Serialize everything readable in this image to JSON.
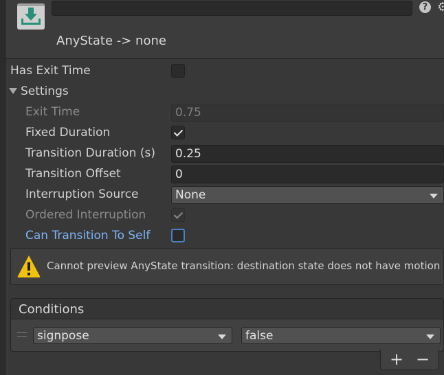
{
  "header": {
    "title": "AnyState -> none",
    "name_value": "",
    "icons": [
      "transition-icon",
      "help-icon",
      "gear-icon"
    ]
  },
  "fields": {
    "has_exit_time": {
      "label": "Has Exit Time",
      "checked": false
    },
    "settings_label": "Settings",
    "exit_time": {
      "label": "Exit Time",
      "value": "0.75"
    },
    "fixed_duration": {
      "label": "Fixed Duration",
      "checked": true
    },
    "transition_duration": {
      "label": "Transition Duration (s)",
      "value": "0.25"
    },
    "transition_offset": {
      "label": "Transition Offset",
      "value": "0"
    },
    "interruption_source": {
      "label": "Interruption Source",
      "value": "None"
    },
    "ordered_interruption": {
      "label": "Ordered Interruption",
      "checked": true
    },
    "can_transition_to_self": {
      "label": "Can Transition To Self",
      "checked": false
    }
  },
  "warning": {
    "text": "Cannot preview AnyState transition:  destination state does not have motion"
  },
  "conditions": {
    "title": "Conditions",
    "rows": [
      {
        "parameter": "signpose",
        "value": "false"
      }
    ],
    "add_label": "+",
    "remove_label": "−"
  },
  "colors": {
    "background": "#383838",
    "link": "#7db4f5",
    "warning": "#f2c10f",
    "transition_icon": "#2a8f7a"
  }
}
